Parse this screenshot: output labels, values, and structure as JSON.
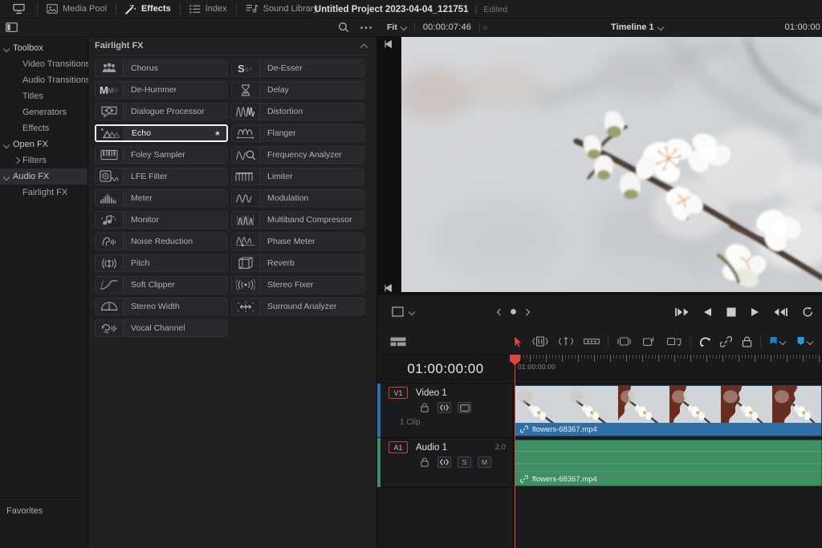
{
  "topbar": {
    "app_icon": "projector-icon",
    "items": [
      {
        "label": "Media Pool",
        "icon": "media-pool-icon",
        "active": false
      },
      {
        "label": "Effects",
        "icon": "effects-wand-icon",
        "active": true
      },
      {
        "label": "Index",
        "icon": "index-list-icon",
        "active": false
      },
      {
        "label": "Sound Library",
        "icon": "sound-library-icon",
        "active": false
      }
    ],
    "project_title": "Untitled Project 2023-04-04_121751",
    "divider": "|",
    "project_state": "Edited"
  },
  "search": {
    "value": "",
    "placeholder": "",
    "search_icon": "search-icon",
    "more_icon": "more-options-icon",
    "panel_toggle_icon": "panel-layout-icon"
  },
  "viewer_header": {
    "fit_label": "Fit",
    "timecode_left": "00:00:07:46",
    "timeline_name": "Timeline 1",
    "timecode_right": "01:00:00"
  },
  "sidebar": {
    "items": [
      {
        "label": "Toolbox",
        "level": 1,
        "expanded": true,
        "selected": false,
        "twisty": "chevron-down-icon"
      },
      {
        "label": "Video Transitions",
        "level": 2,
        "expanded": false,
        "selected": false,
        "twisty": ""
      },
      {
        "label": "Audio Transitions",
        "level": 2,
        "expanded": false,
        "selected": false,
        "twisty": ""
      },
      {
        "label": "Titles",
        "level": 2,
        "expanded": false,
        "selected": false,
        "twisty": ""
      },
      {
        "label": "Generators",
        "level": 2,
        "expanded": false,
        "selected": false,
        "twisty": ""
      },
      {
        "label": "Effects",
        "level": 2,
        "expanded": false,
        "selected": false,
        "twisty": ""
      },
      {
        "label": "Open FX",
        "level": 1,
        "expanded": true,
        "selected": false,
        "twisty": "chevron-down-icon"
      },
      {
        "label": "Filters",
        "level": 2,
        "expanded": false,
        "selected": false,
        "twisty": "chevron-right-icon"
      },
      {
        "label": "Audio FX",
        "level": 1,
        "expanded": true,
        "selected": true,
        "twisty": "chevron-down-icon"
      },
      {
        "label": "Fairlight FX",
        "level": 2,
        "expanded": false,
        "selected": false,
        "twisty": ""
      }
    ],
    "favorites_label": "Favorites"
  },
  "fx_panel": {
    "header": "Fairlight FX",
    "collapse_icon": "chevron-up-icon",
    "items": [
      {
        "label": "Chorus",
        "icon": "chorus-icon",
        "selected": false,
        "favorite": false
      },
      {
        "label": "De-Esser",
        "icon": "de-esser-icon",
        "selected": false,
        "favorite": false
      },
      {
        "label": "De-Hummer",
        "icon": "de-hummer-icon",
        "selected": false,
        "favorite": false
      },
      {
        "label": "Delay",
        "icon": "delay-hourglass-icon",
        "selected": false,
        "favorite": false
      },
      {
        "label": "Dialogue Processor",
        "icon": "dialogue-processor-icon",
        "selected": false,
        "favorite": false
      },
      {
        "label": "Distortion",
        "icon": "distortion-icon",
        "selected": false,
        "favorite": false
      },
      {
        "label": "Echo",
        "icon": "echo-icon",
        "selected": true,
        "favorite": true
      },
      {
        "label": "Flanger",
        "icon": "flanger-icon",
        "selected": false,
        "favorite": false
      },
      {
        "label": "Foley Sampler",
        "icon": "foley-sampler-icon",
        "selected": false,
        "favorite": false
      },
      {
        "label": "Frequency Analyzer",
        "icon": "frequency-analyzer-icon",
        "selected": false,
        "favorite": false
      },
      {
        "label": "LFE Filter",
        "icon": "lfe-filter-icon",
        "selected": false,
        "favorite": false
      },
      {
        "label": "Limiter",
        "icon": "limiter-icon",
        "selected": false,
        "favorite": false
      },
      {
        "label": "Meter",
        "icon": "meter-icon",
        "selected": false,
        "favorite": false
      },
      {
        "label": "Modulation",
        "icon": "modulation-icon",
        "selected": false,
        "favorite": false
      },
      {
        "label": "Monitor",
        "icon": "monitor-icon",
        "selected": false,
        "favorite": false
      },
      {
        "label": "Multiband Compressor",
        "icon": "multiband-compressor-icon",
        "selected": false,
        "favorite": false
      },
      {
        "label": "Noise Reduction",
        "icon": "noise-reduction-icon",
        "selected": false,
        "favorite": false
      },
      {
        "label": "Phase Meter",
        "icon": "phase-meter-icon",
        "selected": false,
        "favorite": false
      },
      {
        "label": "Pitch",
        "icon": "pitch-icon",
        "selected": false,
        "favorite": false
      },
      {
        "label": "Reverb",
        "icon": "reverb-cube-icon",
        "selected": false,
        "favorite": false
      },
      {
        "label": "Soft Clipper",
        "icon": "soft-clipper-icon",
        "selected": false,
        "favorite": false
      },
      {
        "label": "Stereo Fixer",
        "icon": "stereo-fixer-icon",
        "selected": false,
        "favorite": false
      },
      {
        "label": "Stereo Width",
        "icon": "stereo-width-icon",
        "selected": false,
        "favorite": false
      },
      {
        "label": "Surround Analyzer",
        "icon": "surround-analyzer-icon",
        "selected": false,
        "favorite": false
      },
      {
        "label": "Vocal Channel",
        "icon": "vocal-channel-icon",
        "selected": false,
        "favorite": false
      }
    ],
    "star_glyph": "★"
  },
  "viewer": {
    "mark_in_icon": "mark-in-icon",
    "mark_out_icon": "mark-out-icon",
    "image_description": "cherry blossom branch on pale gray sky"
  },
  "transport": {
    "crop_icon": "frame-crop-icon",
    "crop_chevron": "chevron-down-icon",
    "keyframe_prev": "prev-keyframe-icon",
    "keyframe_dot": "keyframe-icon",
    "keyframe_next": "next-keyframe-icon",
    "buttons": [
      {
        "name": "jump-to-start-button",
        "icon": "skip-back-icon"
      },
      {
        "name": "play-reverse-button",
        "icon": "play-reverse-icon"
      },
      {
        "name": "stop-button",
        "icon": "stop-icon"
      },
      {
        "name": "play-button",
        "icon": "play-icon"
      },
      {
        "name": "jump-to-end-button",
        "icon": "skip-forward-icon"
      },
      {
        "name": "loop-button",
        "icon": "loop-icon"
      }
    ]
  },
  "timeline_toolbar": {
    "view_icon": "timeline-view-options-icon",
    "tools": [
      {
        "name": "selection-tool",
        "icon": "arrow-select-icon",
        "active": true
      },
      {
        "name": "trim-edit-tool",
        "icon": "trim-edit-icon",
        "active": false
      },
      {
        "name": "dynamic-trim-tool",
        "icon": "dynamic-trim-icon",
        "active": false
      },
      {
        "name": "blade-edit-tool",
        "icon": "blade-icon",
        "active": false
      }
    ],
    "edit_tools": [
      {
        "name": "insert-clip-button",
        "icon": "insert-clip-icon"
      },
      {
        "name": "overwrite-clip-button",
        "icon": "overwrite-clip-icon"
      },
      {
        "name": "replace-clip-button",
        "icon": "replace-clip-icon"
      }
    ],
    "toggles": [
      {
        "name": "snapping-toggle",
        "icon": "magnet-icon"
      },
      {
        "name": "link-toggle",
        "icon": "link-icon"
      },
      {
        "name": "lock-toggle",
        "icon": "lock-icon"
      }
    ],
    "chips": [
      {
        "name": "flag-button",
        "icon": "flag-icon",
        "color": "#1e7fd4",
        "chevron": "chevron-down-icon"
      },
      {
        "name": "marker-button",
        "icon": "marker-icon",
        "color": "#1e9cd7",
        "chevron": "chevron-down-icon"
      }
    ]
  },
  "timeline": {
    "timecode": "01:00:00:00",
    "ruler_label": "01:00:00:00",
    "playhead_color": "#e0453a",
    "tracks": [
      {
        "badge": "V1",
        "name": "Video 1",
        "clip_count": "1 Clip",
        "channels": "",
        "accent_color": "#2f6fa8",
        "controls": [
          {
            "name": "track-lock-button",
            "icon": "lock-icon",
            "label": ""
          },
          {
            "name": "track-link-button",
            "icon": "link-brackets-icon",
            "label": ""
          },
          {
            "name": "track-video-button",
            "icon": "frame-icon",
            "label": ""
          }
        ]
      },
      {
        "badge": "A1",
        "name": "Audio 1",
        "clip_count": "",
        "channels": "2.0",
        "accent_color": "#3f8f63",
        "controls": [
          {
            "name": "track-lock-button",
            "icon": "lock-icon",
            "label": ""
          },
          {
            "name": "track-link-button",
            "icon": "link-brackets-icon",
            "label": ""
          },
          {
            "name": "track-solo-button",
            "icon": "",
            "label": "S"
          },
          {
            "name": "track-mute-button",
            "icon": "",
            "label": "M"
          }
        ]
      }
    ],
    "clips": [
      {
        "track": "V1",
        "name": "flowers-68367.mp4",
        "link_icon": "link-icon",
        "color": "#2f6fa8"
      },
      {
        "track": "A1",
        "name": "flowers-68367.mp4",
        "link_icon": "link-icon",
        "color": "#3f8f63"
      }
    ]
  }
}
